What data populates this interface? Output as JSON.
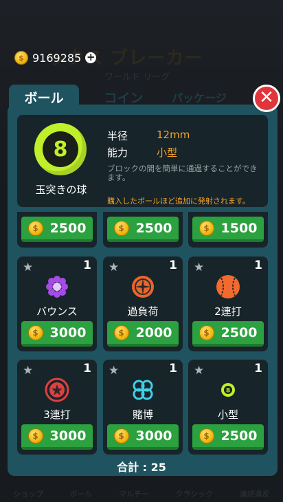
{
  "header": {
    "coins": "9169285",
    "bg_title": "ックス ブレーカー",
    "bg_subtitle": "ワールド  リーグ"
  },
  "tabs": [
    {
      "label": "ボール"
    },
    {
      "label": "コイン"
    },
    {
      "label": "パッケージ"
    }
  ],
  "close_label": "✕",
  "selected": {
    "name": "玉突きの球",
    "ball_number": "8",
    "radius_label": "半径",
    "radius_value": "12mm",
    "ability_label": "能力",
    "ability_value": "小型",
    "description": "ブロックの間を簡単に通過することができます。",
    "note": "購入したボールほど追加に発射されます。"
  },
  "top_prices": [
    "2500",
    "2500",
    "1500"
  ],
  "items": [
    {
      "name": "バウンス",
      "count": "1",
      "price": "3000",
      "icon": "flower-icon"
    },
    {
      "name": "過負荷",
      "count": "1",
      "price": "2000",
      "icon": "compass-icon"
    },
    {
      "name": "2連打",
      "count": "1",
      "price": "2500",
      "icon": "baseball-icon"
    },
    {
      "name": "3連打",
      "count": "1",
      "price": "3000",
      "icon": "star-ring-icon"
    },
    {
      "name": "賭博",
      "count": "1",
      "price": "3000",
      "icon": "clover-icon"
    },
    {
      "name": "小型",
      "count": "1",
      "price": "2500",
      "icon": "small-8ball-icon"
    }
  ],
  "total": "合計 : 25",
  "bottom_nav": [
    "ショップ",
    "ボール",
    "マルチー",
    "クラシック",
    "連続違反"
  ],
  "colors": {
    "panel": "#1f5360",
    "card": "#172429",
    "button": "#2ca13f",
    "accent": "#f4a52a",
    "close": "#e0353b"
  }
}
